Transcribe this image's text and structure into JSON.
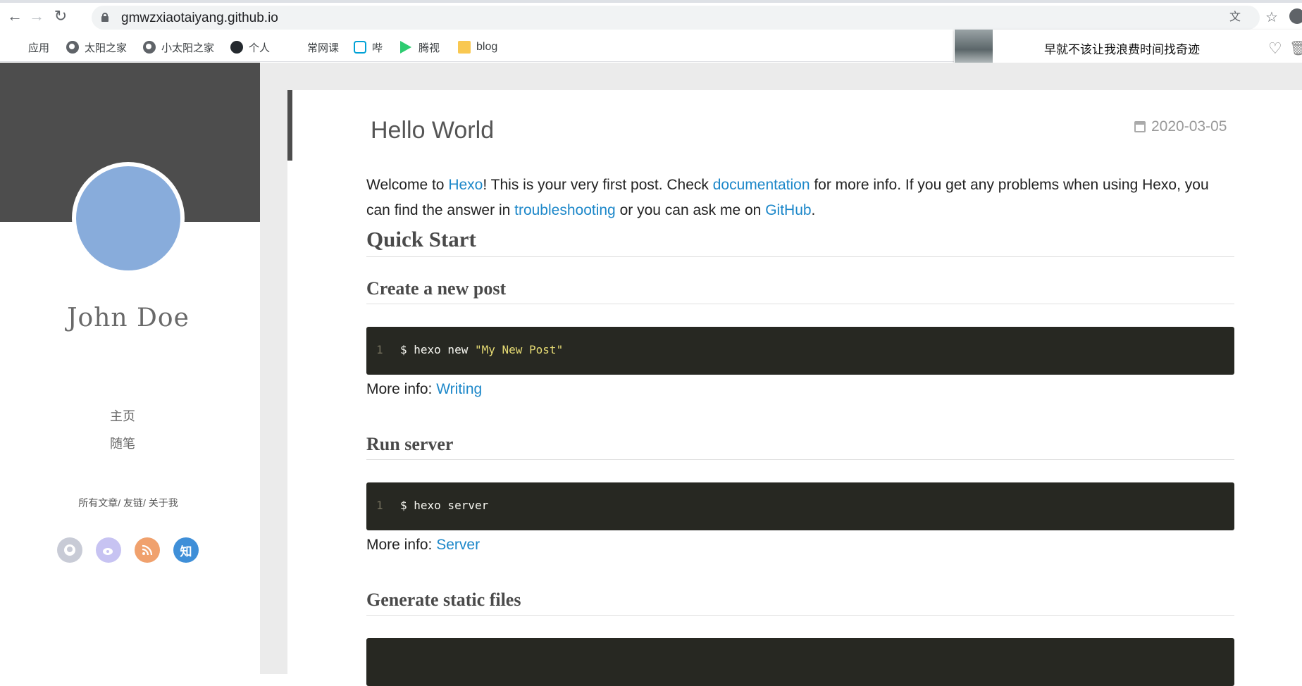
{
  "browser": {
    "url": "gmwzxiaotaiyang.github.io"
  },
  "bookmarks": [
    {
      "label": "应用",
      "icon": "apps-grid-icon"
    },
    {
      "label": "太阳之家",
      "icon": "globe-icon"
    },
    {
      "label": "小太阳之家",
      "icon": "globe-icon"
    },
    {
      "label": "个人",
      "icon": "github-icon"
    },
    {
      "label": "常网课",
      "icon": ""
    },
    {
      "label": "哔",
      "icon": "bilibili-icon"
    },
    {
      "label": "腾视",
      "icon": "tencent-video-icon"
    },
    {
      "label": "blog",
      "icon": "folder-icon"
    }
  ],
  "notice": {
    "text": "早就不该让我浪费时间找奇迹"
  },
  "sidebar": {
    "author": "John Doe",
    "menu": [
      {
        "label": "主页"
      },
      {
        "label": "随笔"
      }
    ],
    "links": [
      {
        "label": "所有文章"
      },
      {
        "label": "友链"
      },
      {
        "label": "关于我"
      }
    ],
    "social": [
      {
        "icon": "github-icon",
        "color": "#c8cbd6"
      },
      {
        "icon": "weibo-icon",
        "color": "#c7c3f2"
      },
      {
        "icon": "rss-icon",
        "color": "#f0a16d"
      },
      {
        "icon": "zhihu-icon",
        "label": "知",
        "color": "#3f8fd8"
      }
    ]
  },
  "post": {
    "title": "Hello World",
    "date": "2020-03-05",
    "intro": {
      "t1": "Welcome to ",
      "l1": "Hexo",
      "t2": "! This is your very first post. Check ",
      "l2": "documentation",
      "t3": " for more info. If you get any problems when using Hexo, you can find the answer in ",
      "l3": "troubleshooting",
      "t4": " or you can ask me on ",
      "l4": "GitHub",
      "t5": "."
    },
    "quick_start": "Quick Start",
    "sections": [
      {
        "heading": "Create a new post",
        "line_no": "1",
        "code_cmd": "$ hexo new ",
        "code_str": "\"My New Post\"",
        "more_label": "More info: ",
        "more_link": "Writing"
      },
      {
        "heading": "Run server",
        "line_no": "1",
        "code_cmd": "$ hexo server",
        "code_str": "",
        "more_label": "More info: ",
        "more_link": "Server"
      },
      {
        "heading": "Generate static files"
      }
    ]
  }
}
